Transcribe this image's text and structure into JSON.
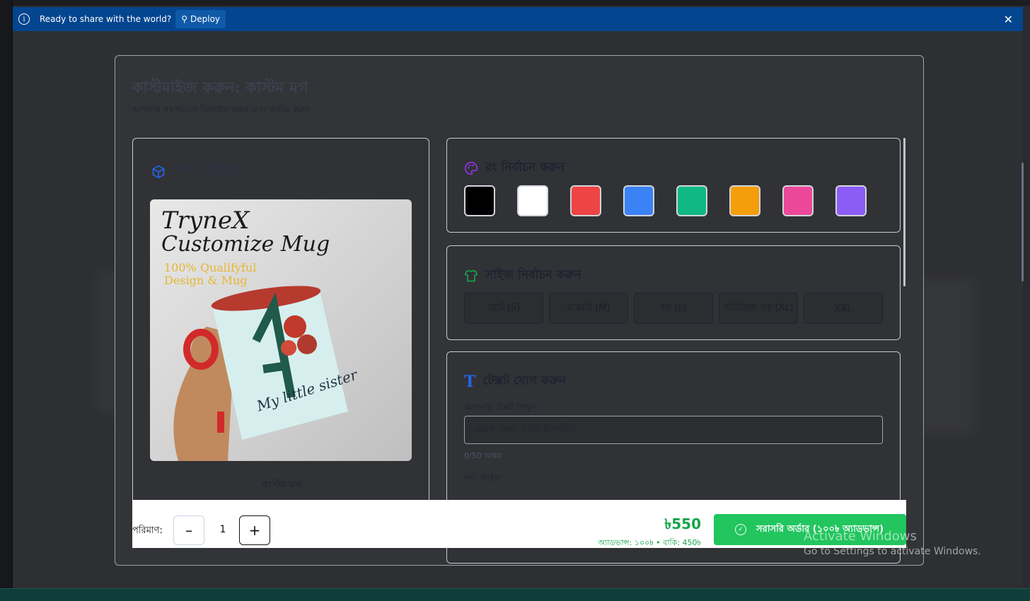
{
  "deploy_bar": {
    "message": "Ready to share with the world?",
    "deploy_label": "Deploy",
    "close_symbol": "✕"
  },
  "modal": {
    "title": "কাস্টমাইজ করুন: কাস্টম মগ",
    "subtitle": "আপনার পছন্দমতো ডিজাইন করুন এবং অর্ডার করুন"
  },
  "preview": {
    "heading": "পণ্য প্রিভিউ",
    "icon": "cube-icon",
    "image": {
      "line1": "TryneX",
      "line2": "Customize Mug",
      "line3": "100% Qualifyful",
      "line4": "Design & Mug",
      "mug_text": "My little sister"
    },
    "product_name": "কাস্টম মগ"
  },
  "colors": {
    "heading": "রং নির্বাচন করুন",
    "icon": "palette-icon",
    "swatches": [
      "#000000",
      "#ffffff",
      "#ef4444",
      "#3b82f6",
      "#10b981",
      "#f59e0b",
      "#ec4899",
      "#8b5cf6"
    ]
  },
  "sizes": {
    "heading": "সাইজ নির্বাচন করুন",
    "icon": "shirt-icon",
    "options": [
      "ছোট (S)",
      "মাঝারি (M)",
      "বড় (L)",
      "অতিরিক্ত বড় (XL)",
      "XXL"
    ]
  },
  "text_panel": {
    "heading": "টেক্সট যোগ করুন",
    "icon": "text-icon",
    "field_label": "আপনার টেক্সট লিখুন",
    "placeholder": "যেমন: নাম, বার্তা ইত্যাদি...",
    "counter": "0/50 অক্ষর",
    "font_label": "ফন্ট স্টাইল"
  },
  "footer": {
    "qty_label": "পরিমাণ:",
    "minus": "–",
    "plus": "+",
    "quantity": "1",
    "price": "৳550",
    "price_note": "অ্যাডভান্স: ১০০৳ • বাকি: 450৳",
    "order_label": "সরাসরি অর্ডার (১০০৳ অ্যাডভান্স)"
  },
  "watermark": {
    "line1": "Activate Windows",
    "line2": "Go to Settings to activate Windows."
  },
  "accent_colors": {
    "deploy_bar": "#03458f",
    "order_button": "#22c55e",
    "price_text": "#16a34a"
  }
}
